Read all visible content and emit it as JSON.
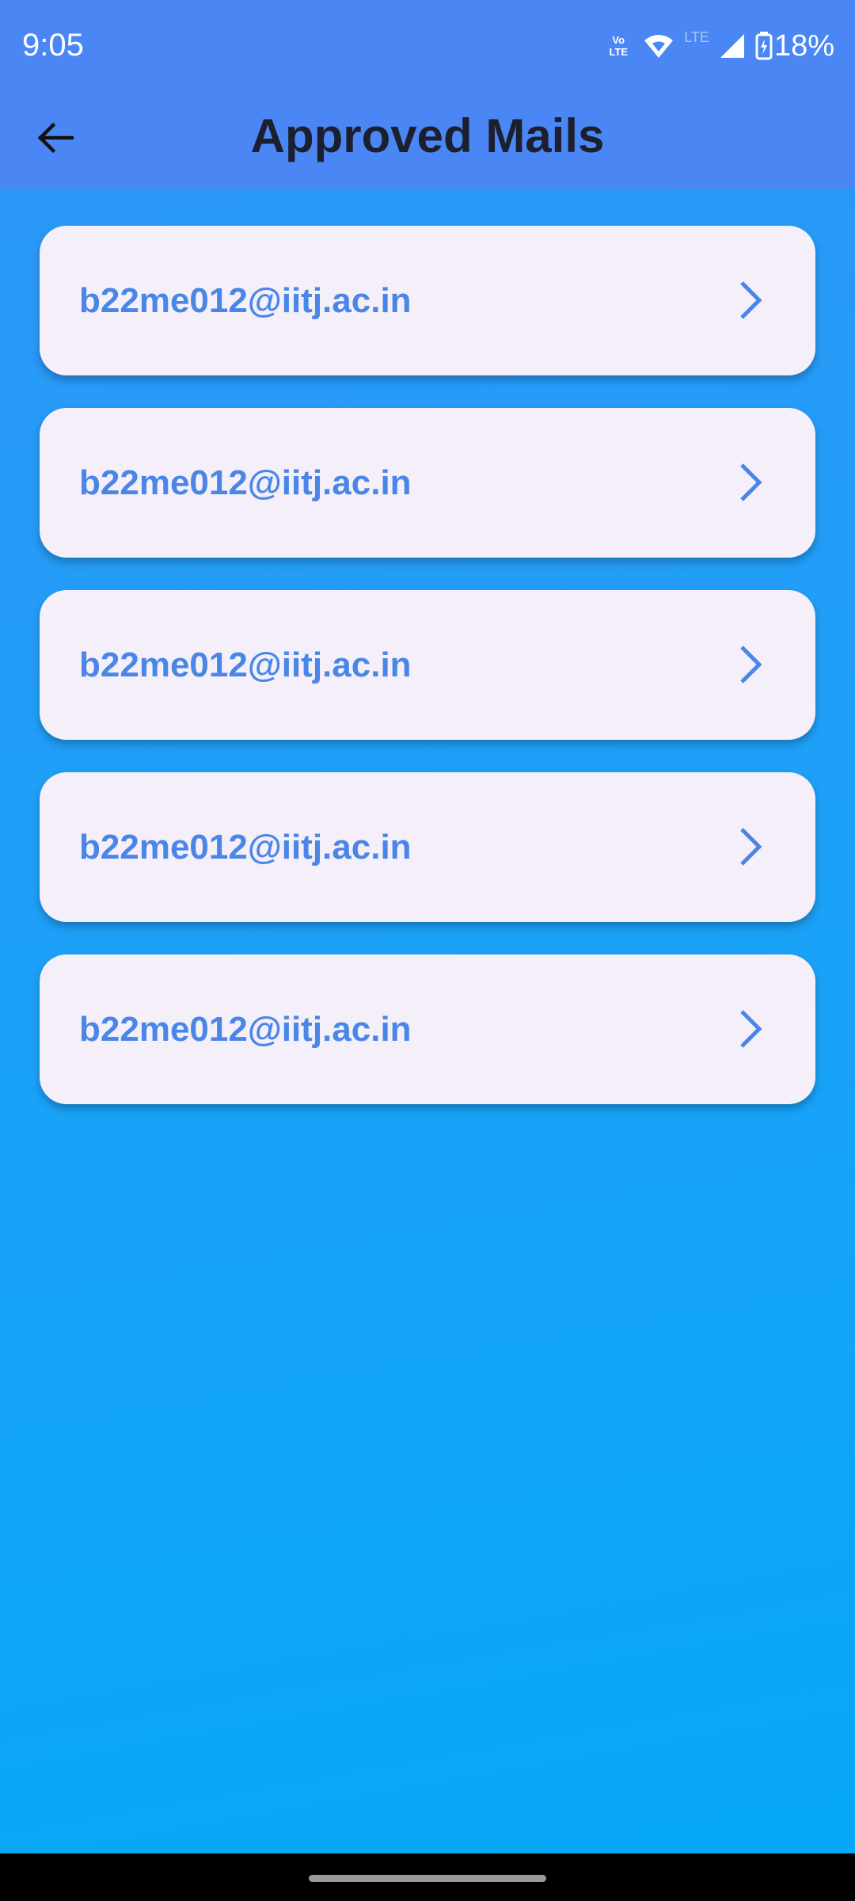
{
  "status_bar": {
    "time": "9:05",
    "volte_top": "Vo",
    "volte_bottom": "LTE",
    "lte_label": "LTE",
    "battery_percent": "18%"
  },
  "app_bar": {
    "title": "Approved Mails",
    "back_icon": "arrow-back-icon"
  },
  "mails": [
    {
      "email": "b22me012@iitj.ac.in"
    },
    {
      "email": "b22me012@iitj.ac.in"
    },
    {
      "email": "b22me012@iitj.ac.in"
    },
    {
      "email": "b22me012@iitj.ac.in"
    },
    {
      "email": "b22me012@iitj.ac.in"
    }
  ],
  "colors": {
    "app_bar": "#4b87f4",
    "accent_text": "#4a86e8",
    "card_background": "#f4eff8"
  }
}
